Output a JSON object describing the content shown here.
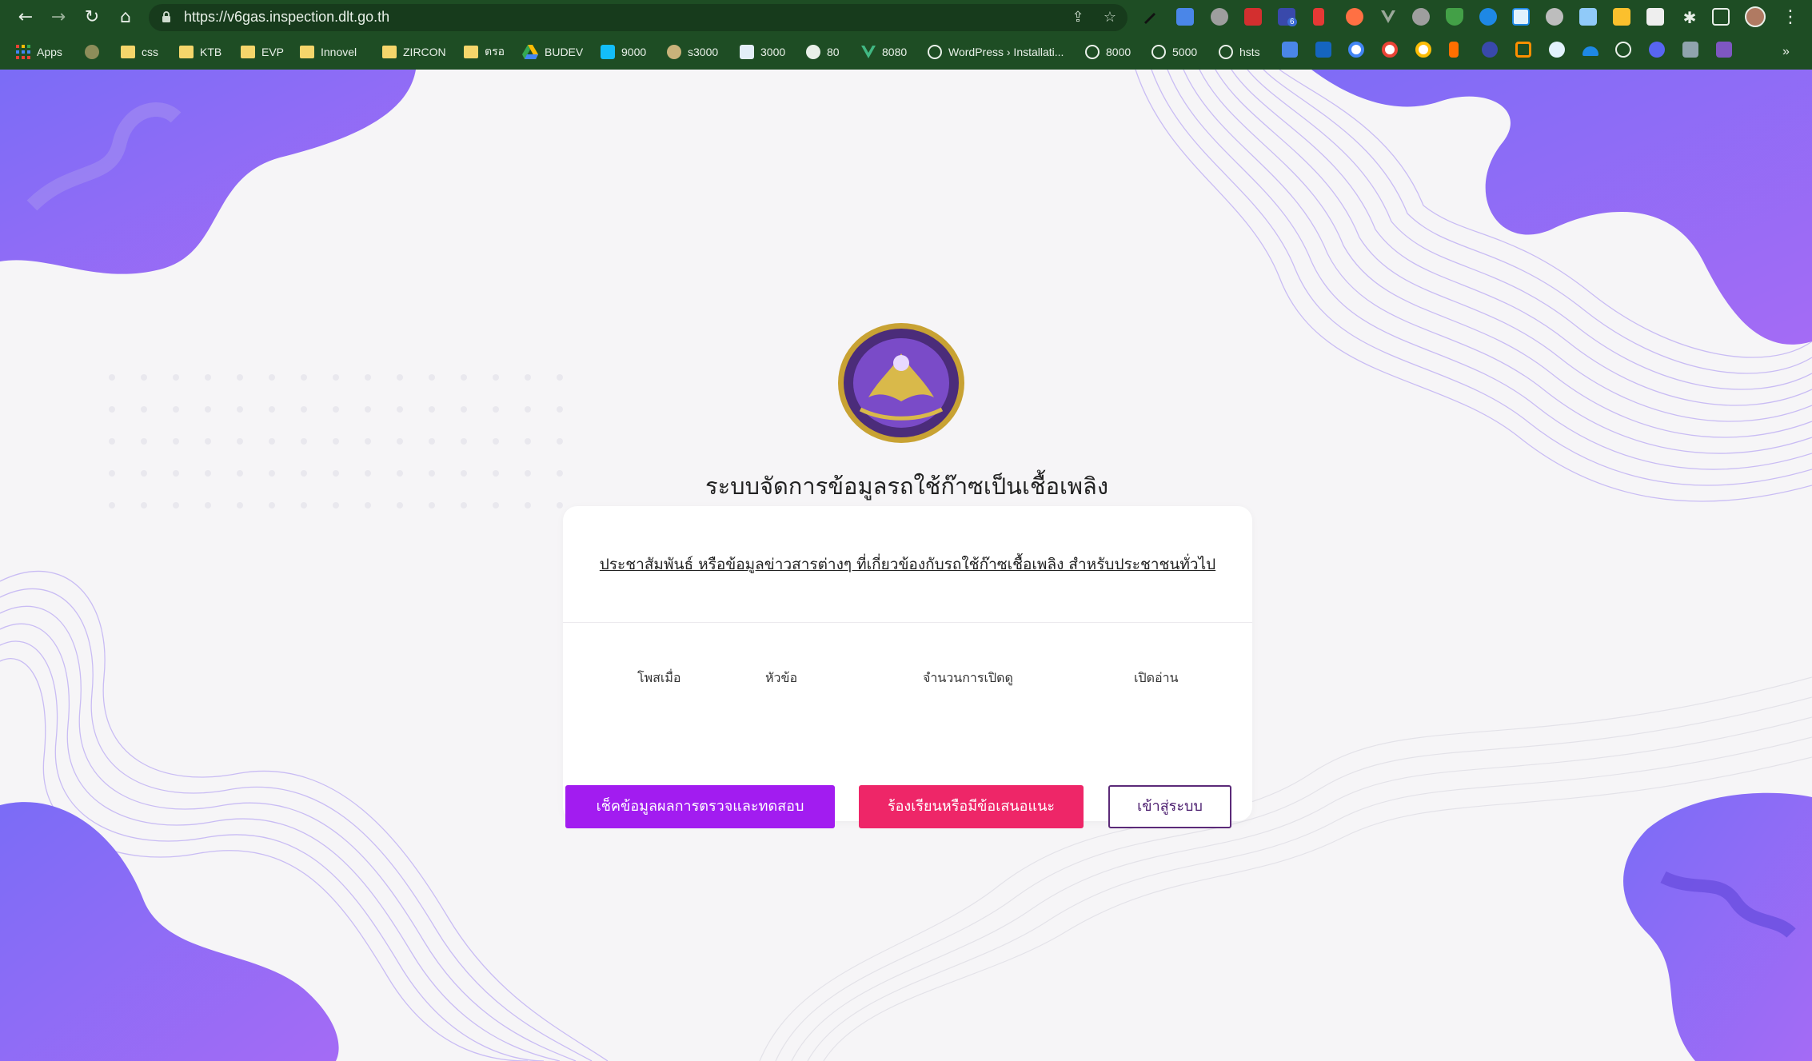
{
  "browser": {
    "url": "https://v6gas.inspection.dlt.go.th",
    "extension_badge": "6",
    "bookmarks": [
      {
        "label": "Apps",
        "icon": "apps-grid-icon"
      },
      {
        "label": "",
        "icon": "extension-hex-icon"
      },
      {
        "label": "css",
        "icon": "folder-icon"
      },
      {
        "label": "KTB",
        "icon": "folder-icon"
      },
      {
        "label": "EVP",
        "icon": "folder-icon"
      },
      {
        "label": "Innovel",
        "icon": "folder-icon"
      },
      {
        "label": "ZIRCON",
        "icon": "folder-icon"
      },
      {
        "label": "ตรอ",
        "icon": "folder-icon"
      },
      {
        "label": "BUDEV",
        "icon": "google-drive-icon"
      },
      {
        "label": "9000",
        "icon": "portainer-icon"
      },
      {
        "label": "s3000",
        "icon": "s3-icon"
      },
      {
        "label": "3000",
        "icon": "k-icon"
      },
      {
        "label": "80",
        "icon": "wordpress-icon"
      },
      {
        "label": "8080",
        "icon": "vue-icon"
      },
      {
        "label": "WordPress › Installati...",
        "icon": "globe-icon"
      },
      {
        "label": "8000",
        "icon": "globe-icon"
      },
      {
        "label": "5000",
        "icon": "globe-icon"
      },
      {
        "label": "hsts",
        "icon": "globe-icon"
      }
    ],
    "overflow": "»"
  },
  "page": {
    "system_title": "ระบบจัดการข้อมูลรถใช้ก๊าซเป็นเชื้อเพลิง",
    "announcement_link": "ประชาสัมพันธ์ หรือข้อมูลข่าวสารต่างๆ ที่เกี่ยวข้องกับรถใช้ก๊าซเชื้อเพลิง สำหรับประชาชนทั่วไป",
    "table_headers": [
      "โพสเมื่อ",
      "หัวข้อ",
      "จำนวนการเปิดดู",
      "เปิดอ่าน"
    ],
    "buttons": {
      "check": "เช็คข้อมูลผลการตรวจและทดสอบ",
      "complaint": "ร้องเรียนหรือมีข้อเสนอแนะ",
      "login": "เข้าสู่ระบบ"
    }
  },
  "colors": {
    "check_button": "#a21cf0",
    "complaint_button": "#ee2668",
    "login_border": "#5b2a78",
    "decor_purple": "#8a63f5"
  }
}
